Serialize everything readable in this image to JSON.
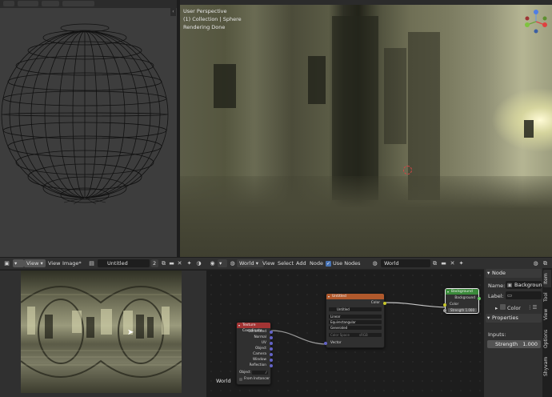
{
  "viewport3d": {
    "view_name": "User Perspective",
    "collection_info": "(1) Collection | Sphere",
    "status": "Rendering Done"
  },
  "image_editor": {
    "view_menu": "View",
    "view_menu2": "View",
    "image_menu": "Image*",
    "image_name": "Untitled",
    "users_count": "2"
  },
  "node_editor": {
    "shader_type": "World",
    "menus": {
      "view": "View",
      "select": "Select",
      "add": "Add",
      "node": "Node"
    },
    "use_nodes_label": "Use Nodes",
    "use_nodes_checked": true,
    "world_name": "World",
    "canvas_label": "World",
    "nodes": {
      "texcoord": {
        "title": "Texture Coordinate",
        "outputs": [
          "Generated",
          "Normal",
          "UV",
          "Object",
          "Camera",
          "Window",
          "Reflection"
        ],
        "object_label": "Object",
        "from_instancer": "From Instancer"
      },
      "envtex": {
        "title": "Untitled",
        "output": "Color",
        "image_name": "Untitled",
        "interpolation": "Linear",
        "projection": "Equirectangular",
        "source": "Generated",
        "colorspace_label": "Color Space",
        "colorspace_value": "sRGB",
        "vector_input": "Vector"
      },
      "background": {
        "title": "Background",
        "output": "Background",
        "color_input": "Color",
        "strength_label": "Strength",
        "strength_value": "1.000"
      }
    }
  },
  "sidebar": {
    "node_section": "Node",
    "name_label": "Name:",
    "name_value": "Background",
    "label_label": "Label:",
    "label_value": "",
    "color_label": "Color",
    "properties_section": "Properties",
    "inputs_label": "Inputs:",
    "strength_label": "Strength",
    "strength_value": "1.000",
    "tabs": [
      "Item",
      "Tool",
      "View",
      "Options",
      "Shyvam"
    ]
  },
  "colors": {
    "texcoord_header": "#a33434",
    "envtex_header": "#b0592c",
    "background_header": "#3a8a3a",
    "socket_vector": "#6363c7",
    "socket_color": "#c7c729",
    "socket_shader": "#63c763",
    "socket_float": "#a1a1a1"
  }
}
